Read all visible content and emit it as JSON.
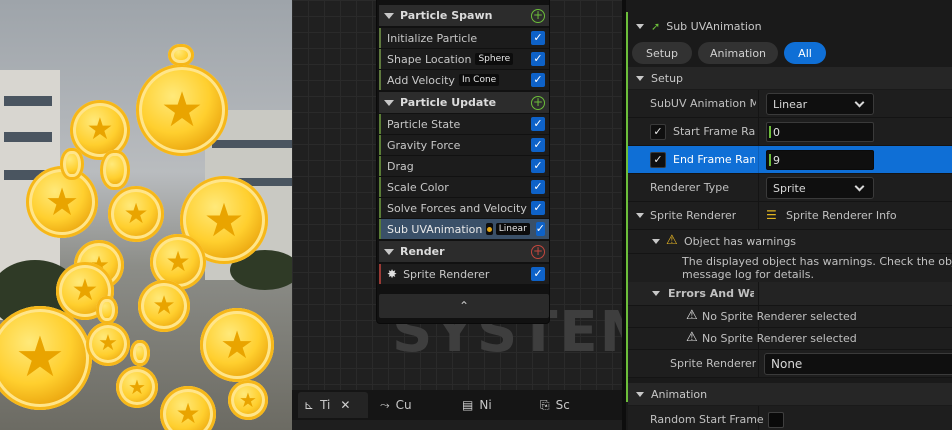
{
  "graph": {
    "watermark": "SYSTEM",
    "stages": [
      {
        "label": "Particle Spawn",
        "modules": [
          {
            "name": "Initialize Particle",
            "pill": "",
            "enabled": true
          },
          {
            "name": "Shape Location",
            "pill": "Sphere",
            "enabled": true
          },
          {
            "name": "Add Velocity",
            "pill": "In Cone",
            "enabled": true
          }
        ]
      },
      {
        "label": "Particle Update",
        "modules": [
          {
            "name": "Particle State",
            "pill": "",
            "enabled": true
          },
          {
            "name": "Gravity Force",
            "pill": "",
            "enabled": true
          },
          {
            "name": "Drag",
            "pill": "",
            "enabled": true
          },
          {
            "name": "Scale Color",
            "pill": "",
            "enabled": true
          },
          {
            "name": "Solve Forces and Velocity",
            "pill": "",
            "enabled": true
          },
          {
            "name": "Sub UVAnimation",
            "pill": "Linear",
            "enabled": true,
            "selected": true
          }
        ]
      },
      {
        "label": "Render",
        "modules": [
          {
            "name": "Sprite Renderer",
            "pill": "",
            "enabled": true
          }
        ]
      }
    ],
    "check_glyph": "✓",
    "add_glyph": "+",
    "collapse_glyph": "⌃"
  },
  "bottom_tabs": [
    {
      "label": "Ti",
      "icon": "timeline-icon",
      "closable": true
    },
    {
      "label": "Cu",
      "icon": "curves-icon",
      "closable": false
    },
    {
      "label": "Ni",
      "icon": "parameters-icon",
      "closable": false
    },
    {
      "label": "Sc",
      "icon": "scratch-pad-icon",
      "closable": false
    }
  ],
  "details": {
    "title": "Sub UVAnimation",
    "filter_tabs": [
      "Setup",
      "Animation",
      "All"
    ],
    "active_filter": "All",
    "setup_section": "Setup",
    "rows": {
      "subuv_mode_label": "SubUV Animation Mo",
      "subuv_mode_value": "Linear",
      "start_frame_label": "Start Frame Rar",
      "start_frame_value": "0",
      "end_frame_label": "End Frame Rang",
      "end_frame_value": "9",
      "renderer_type_label": "Renderer Type",
      "renderer_type_value": "Sprite",
      "sprite_renderer_label": "Sprite Renderer",
      "sprite_renderer_info": "Sprite Renderer Info",
      "warnings_header": "Object has warnings",
      "warnings_text_1": "The displayed object has warnings.  Check the object p",
      "warnings_text_2": "message log for details.",
      "errors_header": "Errors And Warni",
      "error_1": "No Sprite Renderer selected",
      "error_2": "No Sprite Renderer selected",
      "sprite_renderer_select_label": "Sprite Renderer",
      "sprite_renderer_select_value": "None"
    },
    "animation_section": "Animation",
    "random_start_label": "Random Start Frame"
  },
  "colors": {
    "accent_blue": "#0f6fd6",
    "spawn_green": "#6cbe3a",
    "render_red": "#c4473e",
    "warning_yellow": "#e7b524"
  }
}
